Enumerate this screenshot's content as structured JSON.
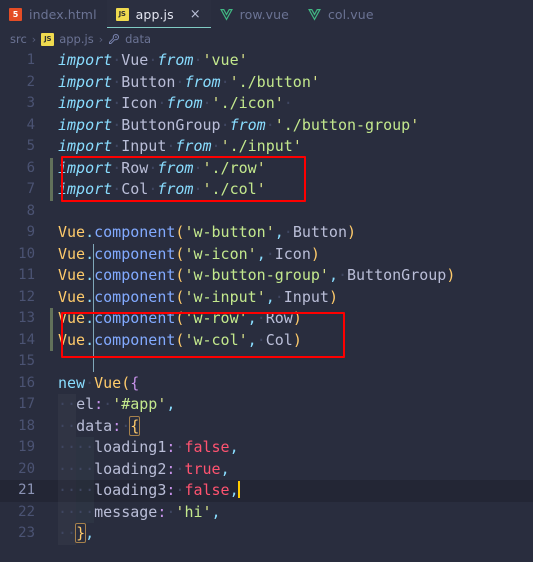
{
  "window": {
    "theme_background": "#292d3e",
    "accent_underline": "#80cbc4",
    "annotation_color": "#fe0000"
  },
  "tabs": [
    {
      "label": "index.html",
      "icon": "html5-icon",
      "icon_text": "5",
      "active": false,
      "closable": false
    },
    {
      "label": "app.js",
      "icon": "js-icon",
      "icon_text": "JS",
      "active": true,
      "closable": true,
      "close_label": "×"
    },
    {
      "label": "row.vue",
      "icon": "vue-icon",
      "icon_text": "V",
      "active": false,
      "closable": false
    },
    {
      "label": "col.vue",
      "icon": "vue-icon",
      "icon_text": "V",
      "active": false,
      "closable": false
    }
  ],
  "breadcrumb": {
    "separator": "›",
    "items": [
      {
        "label": "src",
        "icon": ""
      },
      {
        "label": "app.js",
        "icon": "js-icon",
        "icon_text": "JS"
      },
      {
        "label": "data",
        "icon": "property-icon"
      }
    ]
  },
  "editor": {
    "language": "javascript",
    "active_line": 21,
    "cursor_line": 21,
    "cursor_column": 18,
    "lines": [
      {
        "n": "1",
        "text": "import Vue from 'vue'"
      },
      {
        "n": "2",
        "text": "import Button from './button'"
      },
      {
        "n": "3",
        "text": "import Icon from './icon'"
      },
      {
        "n": "4",
        "text": "import ButtonGroup from './button-group'"
      },
      {
        "n": "5",
        "text": "import Input from './input'"
      },
      {
        "n": "6",
        "text": "import Row from './row'",
        "modified": true
      },
      {
        "n": "7",
        "text": "import Col from './col'",
        "modified": true
      },
      {
        "n": "8",
        "text": ""
      },
      {
        "n": "9",
        "text": "Vue.component('w-button', Button)"
      },
      {
        "n": "10",
        "text": "Vue.component('w-icon', Icon)"
      },
      {
        "n": "11",
        "text": "Vue.component('w-button-group', ButtonGroup)"
      },
      {
        "n": "12",
        "text": "Vue.component('w-input', Input)"
      },
      {
        "n": "13",
        "text": "Vue.component('w-row', Row)",
        "modified": true
      },
      {
        "n": "14",
        "text": "Vue.component('w-col', Col)",
        "modified": true
      },
      {
        "n": "15",
        "text": ""
      },
      {
        "n": "16",
        "text": "new Vue({"
      },
      {
        "n": "17",
        "text": "  el: '#app',"
      },
      {
        "n": "18",
        "text": "  data: {"
      },
      {
        "n": "19",
        "text": "    loading1: false,"
      },
      {
        "n": "20",
        "text": "    loading2: true,"
      },
      {
        "n": "21",
        "text": "    loading3: false,",
        "active": true
      },
      {
        "n": "22",
        "text": "    message: 'hi',"
      },
      {
        "n": "23",
        "text": "  },"
      }
    ]
  },
  "annotations": [
    {
      "name": "import-rows-highlight",
      "covers_lines": "6-7"
    },
    {
      "name": "component-registration-highlight",
      "covers_lines": "13-14"
    }
  ]
}
